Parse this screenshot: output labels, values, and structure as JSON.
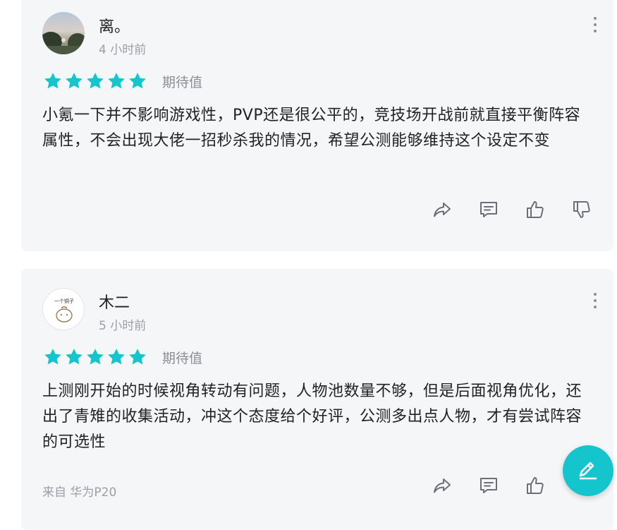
{
  "accent_color": "#15c5ce",
  "reviews": [
    {
      "username": "离。",
      "time": "4 小时前",
      "stars": 5,
      "rating_label": "期待值",
      "content": "小氪一下并不影响游戏性，PVP还是很公平的，竞技场开战前就直接平衡阵容属性，不会出现大佬一招秒杀我的情况，希望公测能够维持这个设定不变",
      "source": "",
      "actions": [
        "share-icon",
        "comment-icon",
        "thumbs-up-icon",
        "thumbs-down-icon"
      ]
    },
    {
      "username": "木二",
      "time": "5 小时前",
      "avatar_text": "一个铜子",
      "stars": 5,
      "rating_label": "期待值",
      "content": "上测刚开始的时候视角转动有问题，人物池数量不够，但是后面视角优化，还出了青雉的收集活动，冲这个态度给个好评，公测多出点人物，才有尝试阵容的可选性",
      "source": "来自 华为P20",
      "actions": [
        "share-icon",
        "comment-icon",
        "thumbs-up-icon",
        "thumbs-down-icon"
      ]
    }
  ],
  "fab": {
    "icon": "edit-pen-icon"
  }
}
